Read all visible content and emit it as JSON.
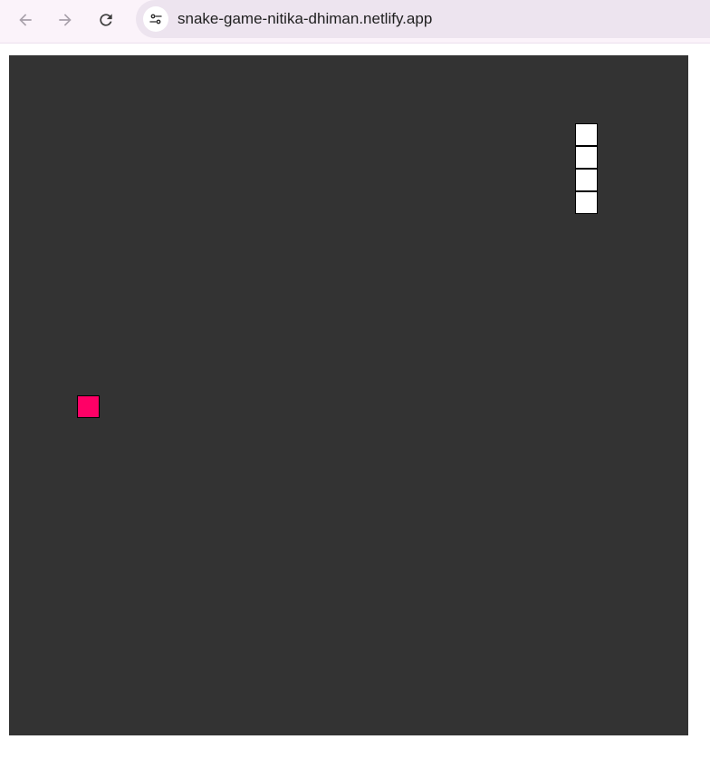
{
  "browser": {
    "url": "snake-game-nitika-dhiman.netlify.app",
    "icons": {
      "back": "arrow-left-icon",
      "forward": "arrow-right-icon",
      "reload": "reload-icon",
      "site_info": "tune-icon"
    }
  },
  "game": {
    "grid_size": 30,
    "colors": {
      "board": "#333333",
      "snake": "#ffffff",
      "food": "#ff0066",
      "cell_border": "#000000"
    },
    "snake": [
      {
        "col": 25,
        "row": 3
      },
      {
        "col": 25,
        "row": 4
      },
      {
        "col": 25,
        "row": 5
      },
      {
        "col": 25,
        "row": 6
      }
    ],
    "food": {
      "col": 3,
      "row": 15
    }
  }
}
